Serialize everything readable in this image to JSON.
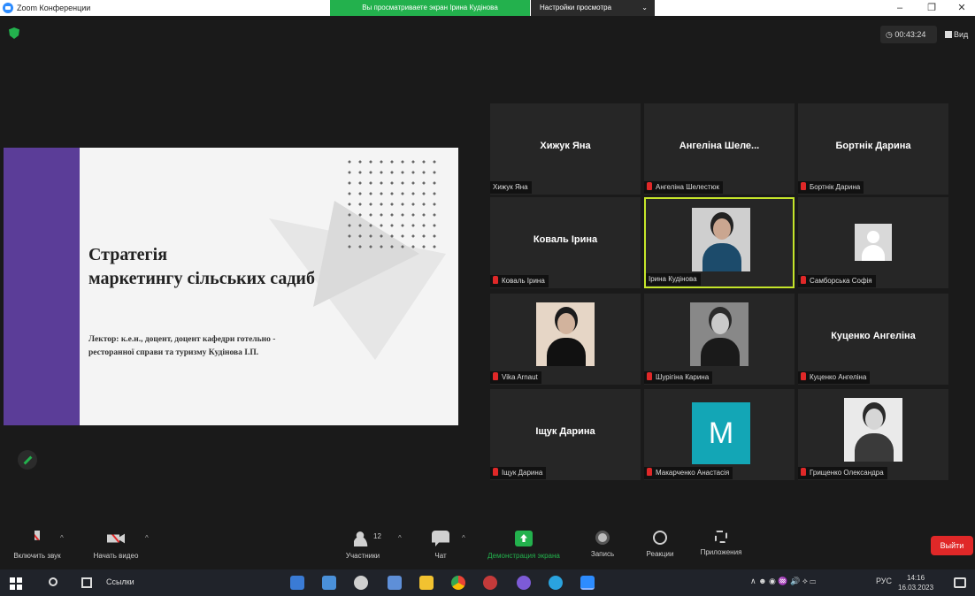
{
  "window": {
    "title": "Zoom Конференции",
    "viewing_banner": "Вы просматриваете экран Ірина Кудінова",
    "view_options": "Настройки просмотра",
    "min_glyph": "–",
    "max_glyph": "❐",
    "close_glyph": "✕"
  },
  "meeting": {
    "timer": "00:43:24",
    "view_label": "Вид"
  },
  "slide": {
    "title_line1": "Стратегія",
    "title_line2": "маркетингу сільських садиб",
    "lecturer_line1": "Лектор: к.е.н., доцент, доцент кафедри  готельно -",
    "lecturer_line2": "ресторанної справи та туризму Кудінова І.П.",
    "accent_color": "#5b3d98"
  },
  "participants": [
    {
      "display": "Хижук Яна",
      "tag": "Хижук Яна",
      "muted": false,
      "type": "name"
    },
    {
      "display": "Ангеліна Шеле...",
      "tag": "Ангеліна Шелестюк",
      "muted": true,
      "type": "name"
    },
    {
      "display": "Бортнік Дарина",
      "tag": "Бортнік Дарина",
      "muted": true,
      "type": "name"
    },
    {
      "display": "Коваль Ірина",
      "tag": "Коваль Ірина",
      "muted": true,
      "type": "name"
    },
    {
      "display": "",
      "tag": "Ірина Кудінова",
      "muted": false,
      "type": "photo",
      "active": true
    },
    {
      "display": "",
      "tag": "Самборська Софія",
      "muted": true,
      "type": "placeholder"
    },
    {
      "display": "",
      "tag": "Vika Arnaut",
      "muted": true,
      "type": "photo"
    },
    {
      "display": "",
      "tag": "Шурігіна Карина",
      "muted": true,
      "type": "photo"
    },
    {
      "display": "Куценко Ангеліна",
      "tag": "Куценко Ангеліна",
      "muted": true,
      "type": "name"
    },
    {
      "display": "Іщук Дарина",
      "tag": "Іщук Дарина",
      "muted": true,
      "type": "name"
    },
    {
      "display": "M",
      "tag": "Макарченко Анастасія",
      "muted": true,
      "type": "initial"
    },
    {
      "display": "",
      "tag": "Грищенко Олександра",
      "muted": true,
      "type": "photo"
    }
  ],
  "toolbar": {
    "unmute": "Включить звук",
    "start_video": "Начать видео",
    "participants": "Участники",
    "participants_count": "12",
    "chat": "Чат",
    "share": "Демонстрация экрана",
    "record": "Запись",
    "reactions": "Реакции",
    "apps": "Приложения",
    "leave": "Выйти"
  },
  "taskbar": {
    "links": "Ссылки",
    "lang": "РУС",
    "time": "14:16",
    "date": "16.03.2023",
    "tray_icons": "∧ ☻ ◉ ♒ 🔊 ⟡ ▭"
  },
  "colors": {
    "green": "#23b14d",
    "red": "#e02828",
    "active_border": "#c5e52a",
    "tile_bg": "#262626"
  }
}
